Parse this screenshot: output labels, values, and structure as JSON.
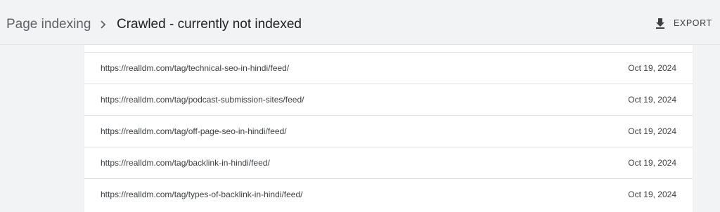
{
  "header": {
    "breadcrumb_parent": "Page indexing",
    "breadcrumb_separator_icon": "chevron-right-icon",
    "title": "Crawled - currently not indexed",
    "export": {
      "icon": "download-icon",
      "label": "EXPORT"
    }
  },
  "table": {
    "rows": [
      {
        "url": "https://realldm.com/tag/technical-seo-in-hindi/feed/",
        "date": "Oct 19, 2024"
      },
      {
        "url": "https://realldm.com/tag/podcast-submission-sites/feed/",
        "date": "Oct 19, 2024"
      },
      {
        "url": "https://realldm.com/tag/off-page-seo-in-hindi/feed/",
        "date": "Oct 19, 2024"
      },
      {
        "url": "https://realldm.com/tag/backlink-in-hindi/feed/",
        "date": "Oct 19, 2024"
      },
      {
        "url": "https://realldm.com/tag/types-of-backlink-in-hindi/feed/",
        "date": "Oct 19, 2024"
      }
    ]
  }
}
